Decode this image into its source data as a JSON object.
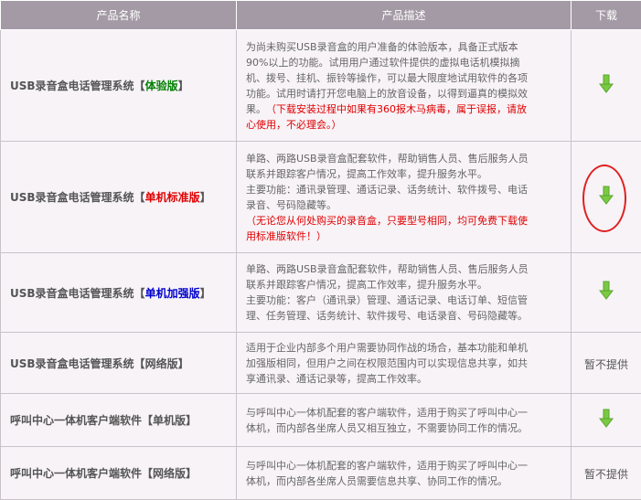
{
  "header": {
    "col_name": "产品名称",
    "col_desc": "产品描述",
    "col_download": "下载"
  },
  "rows": [
    {
      "name_prefix": "USB录音盒电话管理系统",
      "edition_open": "【",
      "edition": "体验版",
      "edition_close": "】",
      "edition_color": "#008000",
      "desc_lines": [
        "为尚未购买USB录音盒的用户准备的体验版本，具备正式版本",
        "90%以上的功能。试用用户通过软件提供的虚拟电话机模拟摘",
        "机、拨号、挂机、振铃等操作，可以最大限度地试用软件的各项",
        "功能。试用时请打开您电脑上的放音设备，以得到逼真的模拟效",
        "果。"
      ],
      "note_inline": "（下载安装过程中如果有360报木马病毒，属于误报，请放",
      "note_lines": [
        "心使用，不必理会。）"
      ],
      "download": "arrow"
    },
    {
      "name_prefix": "USB录音盒电话管理系统",
      "edition_open": "【",
      "edition": "单机标准版",
      "edition_close": "】",
      "edition_color": "#e00000",
      "desc_lines": [
        "单路、两路USB录音盒配套软件，帮助销售人员、售后服务人员",
        "联系并跟踪客户情况，提高工作效率，提升服务水平。",
        "主要功能：通讯录管理、通话记录、话务统计、软件拨号、电话",
        "录音、号码隐藏等。"
      ],
      "note_lines": [
        "（无论您从何处购买的录音盒，只要型号相同，均可免费下载使",
        "用标准版软件！）"
      ],
      "download": "arrow"
    },
    {
      "name_prefix": "USB录音盒电话管理系统",
      "edition_open": "【",
      "edition": "单机加强版",
      "edition_close": "】",
      "edition_color": "#0000cc",
      "desc_lines": [
        "单路、两路USB录音盒配套软件，帮助销售人员、售后服务人员",
        "联系并跟踪客户情况，提高工作效率，提升服务水平。",
        "主要功能：客户（通讯录）管理、通话记录、电话订单、短信管",
        "理、任务管理、话务统计、软件拨号、电话录音、号码隐藏等。"
      ],
      "note_lines": [],
      "download": "arrow"
    },
    {
      "name_prefix": "USB录音盒电话管理系统",
      "edition_open": "【",
      "edition": "网络版",
      "edition_close": "】",
      "edition_color": "#555555",
      "desc_lines": [
        "适用于企业内部多个用户需要协同作战的场合，基本功能和单机",
        "加强版相同，但用户之间在权限范围内可以实现信息共享，如共",
        "享通讯录、通话记录等，提高工作效率。"
      ],
      "note_lines": [],
      "download": "暂不提供"
    },
    {
      "name_prefix": "呼叫中心一体机客户端软件",
      "edition_open": "【",
      "edition": "单机版",
      "edition_close": "】",
      "edition_color": "#555555",
      "desc_lines": [
        "与呼叫中心一体机配套的客户端软件，适用于购买了呼叫中心一",
        "体机，而内部各坐席人员又相互独立，不需要协同工作的情况。"
      ],
      "note_lines": [],
      "download": "arrow"
    },
    {
      "name_prefix": "呼叫中心一体机客户端软件",
      "edition_open": "【",
      "edition": "网络版",
      "edition_close": "】",
      "edition_color": "#555555",
      "desc_lines": [
        "与呼叫中心一体机配套的客户端软件，适用于购买了呼叫中心一",
        "体机，而内部各坐席人员需要信息共享、协同工作的情况。"
      ],
      "note_lines": [],
      "download": "暂不提供"
    }
  ],
  "icons": {
    "download": "download-arrow-icon",
    "highlight": "red-circle-annotation"
  },
  "colors": {
    "header_bg": "#a49aa6",
    "row_bg": "#f7f3f7",
    "arrow": "#7ac943",
    "note": "#e00000"
  }
}
